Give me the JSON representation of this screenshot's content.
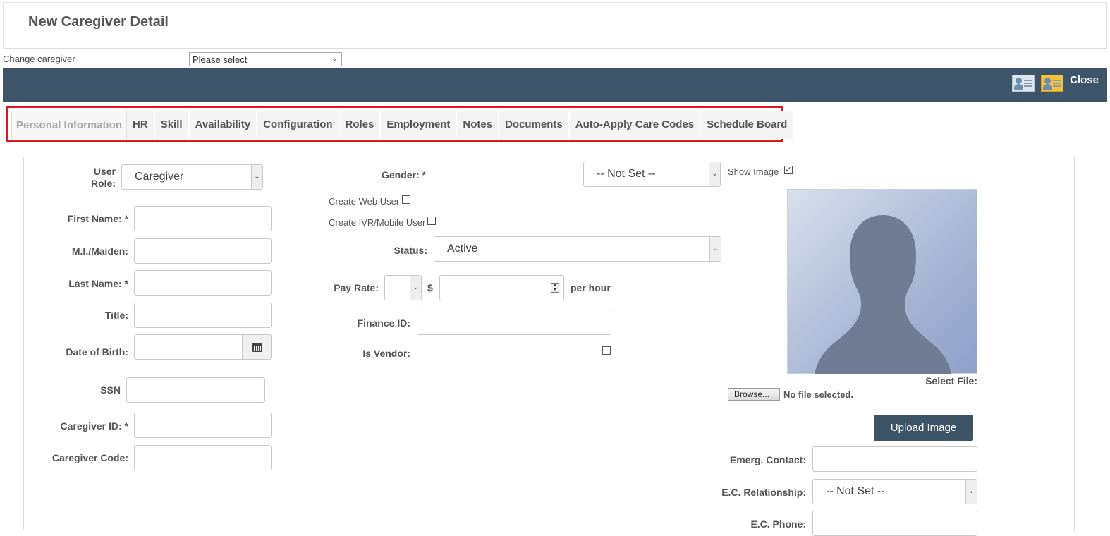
{
  "page": {
    "title": "New Caregiver Detail"
  },
  "change_caregiver": {
    "label": "Change caregiver",
    "value": "Please select"
  },
  "toolbar": {
    "close_label": "Close"
  },
  "tabs": [
    {
      "label": "Personal Information",
      "active": true
    },
    {
      "label": "HR"
    },
    {
      "label": "Skill"
    },
    {
      "label": "Availability"
    },
    {
      "label": "Configuration"
    },
    {
      "label": "Roles"
    },
    {
      "label": "Employment"
    },
    {
      "label": "Notes"
    },
    {
      "label": "Documents"
    },
    {
      "label": "Auto-Apply Care Codes"
    },
    {
      "label": "Schedule Board"
    }
  ],
  "form": {
    "user_role": {
      "label_line1": "User",
      "label_line2": "Role:",
      "value": "Caregiver"
    },
    "first_name": {
      "label": "First Name: *",
      "value": ""
    },
    "mi_maiden": {
      "label": "M.I./Maiden:",
      "value": ""
    },
    "last_name": {
      "label": "Last Name: *",
      "value": ""
    },
    "title": {
      "label": "Title:",
      "value": ""
    },
    "dob": {
      "label": "Date of Birth:",
      "value": ""
    },
    "ssn": {
      "label": "SSN",
      "value": ""
    },
    "caregiver_id": {
      "label": "Caregiver ID: *",
      "value": ""
    },
    "caregiver_code": {
      "label": "Caregiver Code:",
      "value": ""
    },
    "gender": {
      "label": "Gender: *",
      "value": "-- Not Set --"
    },
    "create_web_user": {
      "label": "Create Web User",
      "checked": false
    },
    "create_ivr_user": {
      "label": "Create IVR/Mobile User",
      "checked": false
    },
    "status": {
      "label": "Status:",
      "value": "Active"
    },
    "pay_rate": {
      "label": "Pay Rate:",
      "currency": "$",
      "unit_value": "",
      "amount": "",
      "suffix": "per hour"
    },
    "finance_id": {
      "label": "Finance ID:",
      "value": ""
    },
    "is_vendor": {
      "label": "Is Vendor:",
      "checked": false
    },
    "show_image": {
      "label": "Show Image",
      "checked": true
    },
    "select_file": {
      "label": "Select File:",
      "browse_label": "Browse...",
      "status": "No file selected."
    },
    "upload_button": "Upload Image",
    "emerg_contact": {
      "label": "Emerg. Contact:",
      "value": ""
    },
    "ec_relationship": {
      "label": "E.C. Relationship:",
      "value": "-- Not Set --"
    },
    "ec_phone": {
      "label": "E.C. Phone:",
      "value": ""
    }
  },
  "colors": {
    "toolbar_bg": "#3e5468",
    "tab_highlight": "#e8141b",
    "upload_bg": "#3d5366"
  }
}
